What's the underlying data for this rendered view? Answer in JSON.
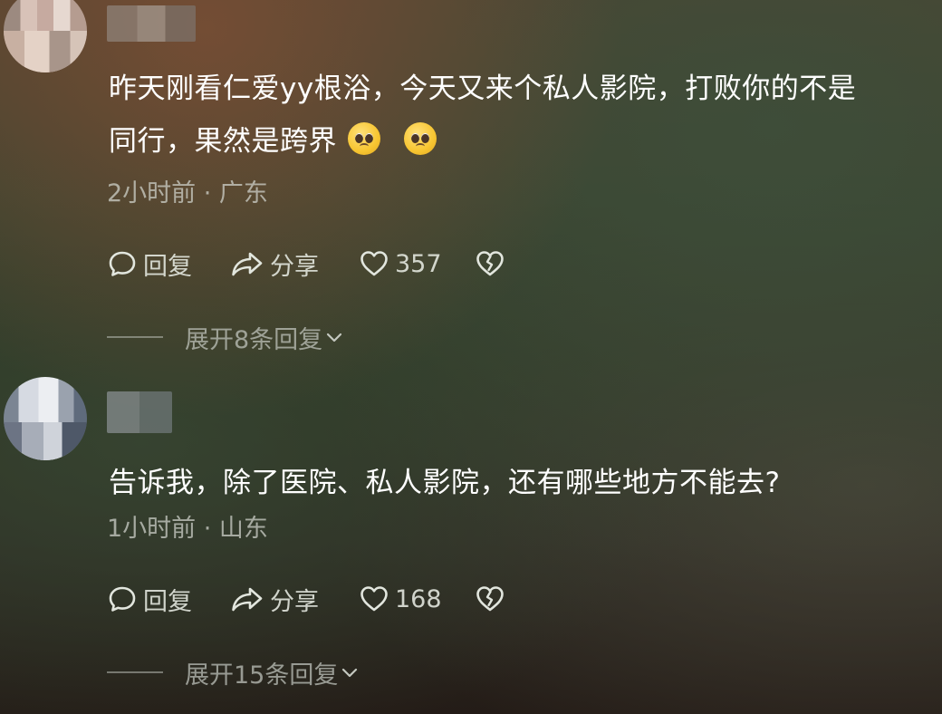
{
  "comments": [
    {
      "text_line1": "昨天刚看仁爱yy根浴，今天又来个私人影院，打败你的不是",
      "text_line2": "同行，果然是跨界",
      "emojis": [
        "crying-face-emoji",
        "crying-face-emoji"
      ],
      "meta": "2小时前 · 广东",
      "reply_label": "回复",
      "share_label": "分享",
      "like_count": "357",
      "expand_label": "展开8条回复"
    },
    {
      "text_line1": "告诉我，除了医院、私人影院，还有哪些地方不能去?",
      "meta": "1小时前 · 山东",
      "reply_label": "回复",
      "share_label": "分享",
      "like_count": "168",
      "expand_label": "展开15条回复"
    }
  ],
  "icons": {
    "reply": "speech-bubble-icon",
    "share": "share-arrow-icon",
    "like": "heart-icon",
    "dislike": "broken-heart-icon",
    "expand": "chevron-down-icon"
  },
  "colors": {
    "text_primary": "#ffffff",
    "text_secondary": "#c4c8c0",
    "emoji_yellow": "#f7c531"
  }
}
